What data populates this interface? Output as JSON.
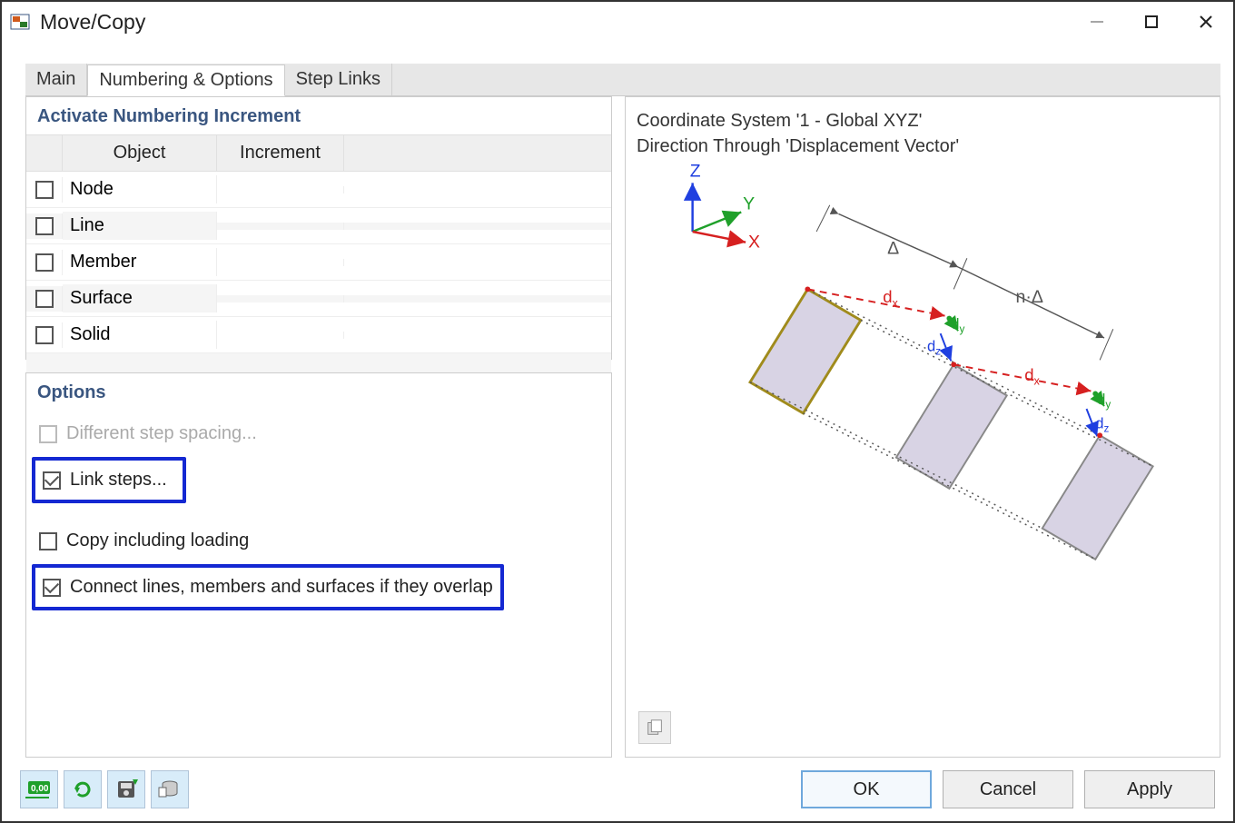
{
  "window": {
    "title": "Move/Copy"
  },
  "tabs": {
    "main": "Main",
    "numbering": "Numbering & Options",
    "steplinks": "Step Links"
  },
  "numbering": {
    "section_title": "Activate Numbering Increment",
    "col_object": "Object",
    "col_increment": "Increment",
    "rows": [
      {
        "label": "Node"
      },
      {
        "label": "Line"
      },
      {
        "label": "Member"
      },
      {
        "label": "Surface"
      },
      {
        "label": "Solid"
      }
    ]
  },
  "options": {
    "section_title": "Options",
    "different_spacing": "Different step spacing...",
    "link_steps": "Link steps...",
    "copy_loading": "Copy including loading",
    "connect_overlap": "Connect lines, members and surfaces if they overlap"
  },
  "preview": {
    "line1": "Coordinate System '1 - Global XYZ'",
    "line2": "Direction Through 'Displacement Vector'",
    "axis_z": "Z",
    "axis_y": "Y",
    "axis_x": "X",
    "delta": "Δ",
    "ndelta": "n·Δ",
    "dx": "d",
    "dx_sub": "x",
    "dy": "d",
    "dy_sub": "y",
    "dz": "d",
    "dz_sub": "z"
  },
  "buttons": {
    "ok": "OK",
    "cancel": "Cancel",
    "apply": "Apply"
  }
}
